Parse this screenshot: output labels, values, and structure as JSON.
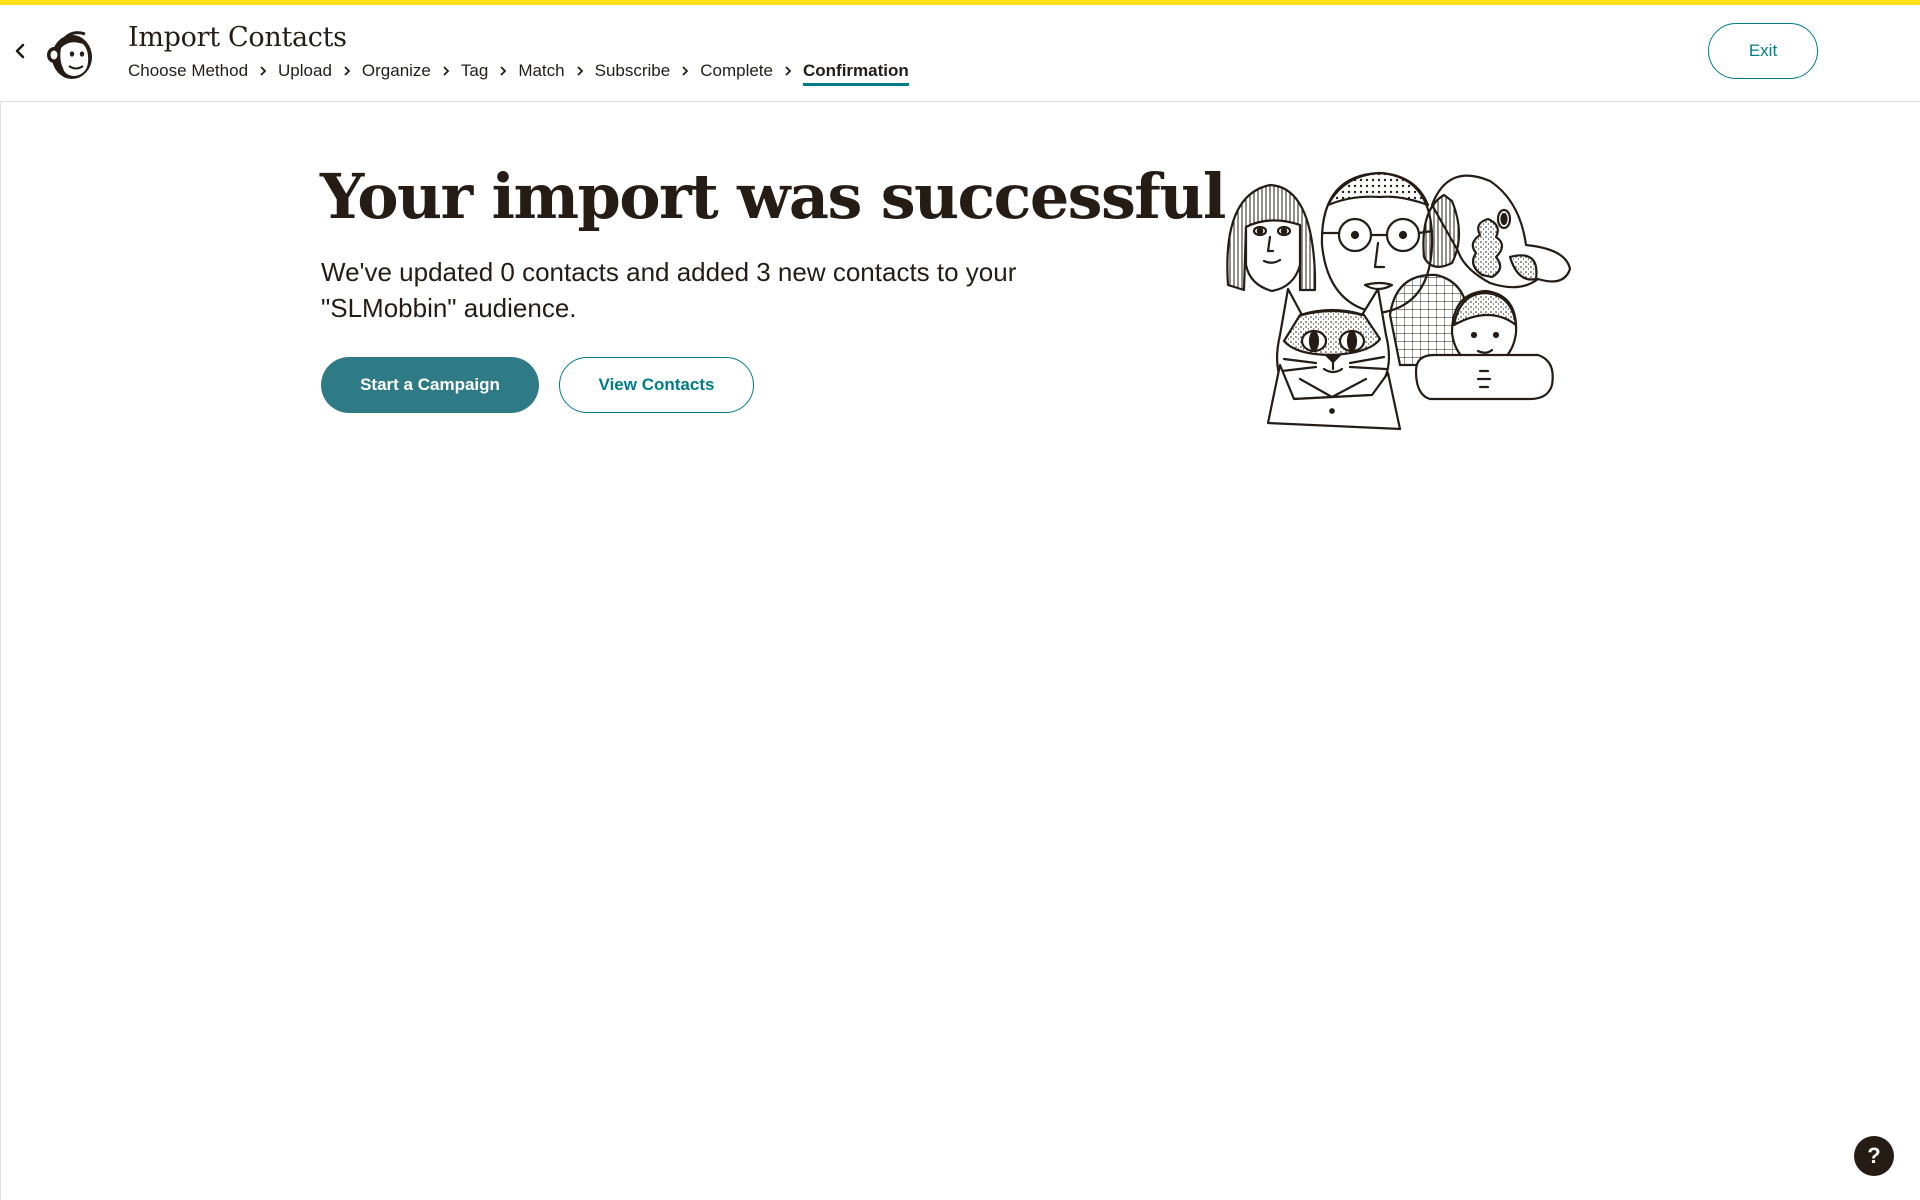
{
  "header": {
    "title": "Import Contacts",
    "back_icon": "chevron-left-icon",
    "logo_icon": "monkey-logo-icon",
    "exit_label": "Exit",
    "steps": [
      {
        "label": "Choose Method",
        "active": false
      },
      {
        "label": "Upload",
        "active": false
      },
      {
        "label": "Organize",
        "active": false
      },
      {
        "label": "Tag",
        "active": false
      },
      {
        "label": "Match",
        "active": false
      },
      {
        "label": "Subscribe",
        "active": false
      },
      {
        "label": "Complete",
        "active": false
      },
      {
        "label": "Confirmation",
        "active": true
      }
    ]
  },
  "main": {
    "headline": "Your import was successful",
    "subtext": "We've updated 0 contacts and added 3 new contacts to your \"SLMobbin\" audience.",
    "primary_button": "Start a Campaign",
    "secondary_button": "View Contacts",
    "illustration_icon": "people-and-pets-illustration"
  },
  "help": {
    "label": "?"
  },
  "colors": {
    "accent_stripe": "#ffe01b",
    "teal": "#007c89",
    "primary_button": "#2f7b85",
    "text": "#241c15"
  }
}
